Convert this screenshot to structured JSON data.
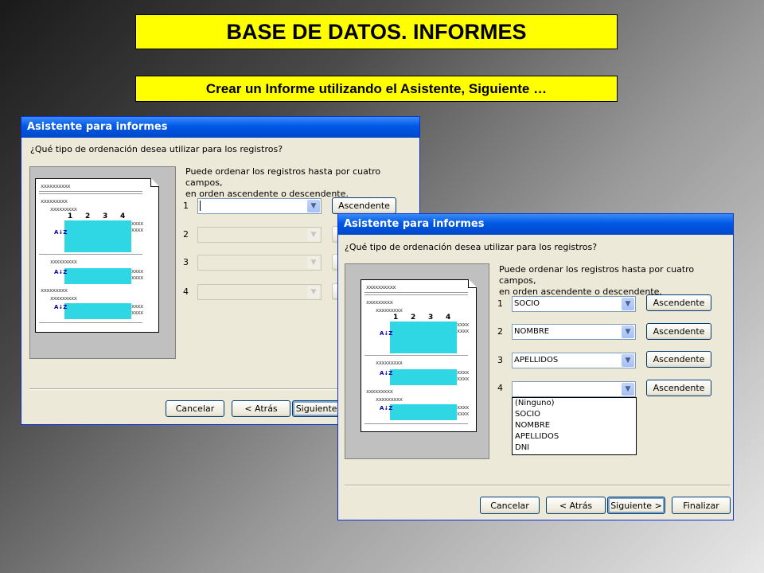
{
  "banner": {
    "title": "BASE DE DATOS. INFORMES",
    "subtitle": "Crear un Informe utilizando el Asistente, Siguiente …"
  },
  "back_window": {
    "title": "Asistente para informes",
    "question": "¿Qué tipo de ordenación desea utilizar para los registros?",
    "instruction_line1": "Puede ordenar los registros hasta por cuatro campos,",
    "instruction_line2": "en orden ascendente o descendente.",
    "rows": [
      {
        "num": "1",
        "value": "",
        "button": "Ascendente"
      },
      {
        "num": "2",
        "value": "",
        "button": ""
      },
      {
        "num": "3",
        "value": "",
        "button": ""
      },
      {
        "num": "4",
        "value": "",
        "button": ""
      }
    ],
    "buttons": {
      "cancel": "Cancelar",
      "back": "< Atrás",
      "next": "Siguiente >"
    }
  },
  "front_window": {
    "title": "Asistente para informes",
    "question": "¿Qué tipo de ordenación desea utilizar para los registros?",
    "instruction_line1": "Puede ordenar los registros hasta por cuatro campos,",
    "instruction_line2": "en orden ascendente o descendente.",
    "rows": [
      {
        "num": "1",
        "value": "SOCIO",
        "button": "Ascendente"
      },
      {
        "num": "2",
        "value": "NOMBRE",
        "button": "Ascendente"
      },
      {
        "num": "3",
        "value": "APELLIDOS",
        "button": "Ascendente"
      },
      {
        "num": "4",
        "value": "",
        "button": "Ascendente"
      }
    ],
    "dropdown_options": [
      "(Ninguno)",
      "SOCIO",
      "NOMBRE",
      "APELLIDOS",
      "DNI"
    ],
    "buttons": {
      "cancel": "Cancelar",
      "back": "< Atrás",
      "next": "Siguiente >",
      "finish": "Finalizar"
    }
  },
  "preview": {
    "placeholder_long": "xxxxxxxxxx",
    "placeholder_mid": "xxxxxxxxx",
    "col_nums": [
      "1",
      "2",
      "3",
      "4"
    ],
    "sort_icon": "A↓Z"
  },
  "colors": {
    "banner": "#ffff00",
    "titlebar": "#0058e6",
    "window_bg": "#ece9d8",
    "grid": "#2fd6e4"
  }
}
